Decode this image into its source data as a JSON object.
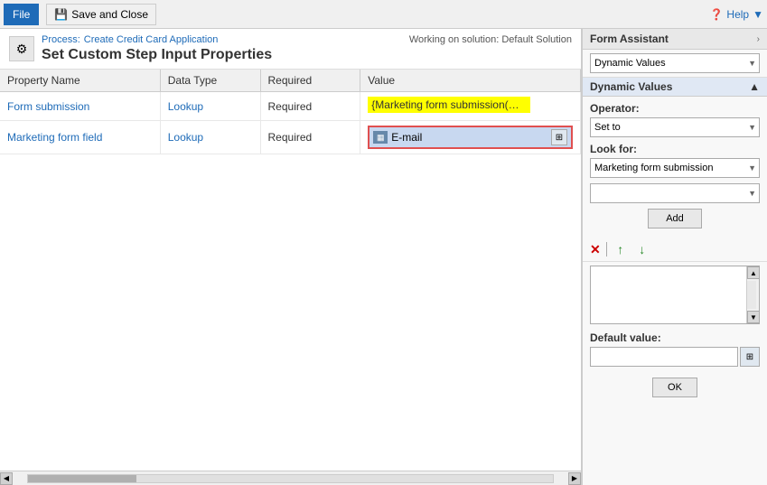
{
  "toolbar": {
    "file_label": "File",
    "save_close_label": "Save and Close",
    "help_label": "Help",
    "help_icon": "?"
  },
  "header": {
    "process_prefix": "Process:",
    "process_name": "Create Credit Card Application",
    "title": "Set Custom Step Input Properties",
    "working_on": "Working on solution: Default Solution",
    "icon": "⚙"
  },
  "table": {
    "columns": [
      "Property Name",
      "Data Type",
      "Required",
      "Value"
    ],
    "rows": [
      {
        "property": "Form submission",
        "type": "Lookup",
        "required": "Required",
        "value": "{Marketing form submission(Mark",
        "value_type": "highlight"
      },
      {
        "property": "Marketing form field",
        "type": "Lookup",
        "required": "Required",
        "value": "E-mail",
        "value_type": "lookup"
      }
    ]
  },
  "right_panel": {
    "title": "Form Assistant",
    "chevron": "›",
    "dynamic_values_label": "Dynamic Values",
    "dynamic_values_section": "Dynamic Values",
    "chevron_up": "▲",
    "operator_label": "Operator:",
    "operator_placeholder": "Set to",
    "look_for_label": "Look for:",
    "look_for_value": "Marketing form submission",
    "second_dropdown": "",
    "add_button": "Add",
    "delete_icon": "✕",
    "up_arrow": "↑",
    "down_arrow": "↓",
    "default_value_label": "Default value:",
    "ok_button": "OK"
  }
}
